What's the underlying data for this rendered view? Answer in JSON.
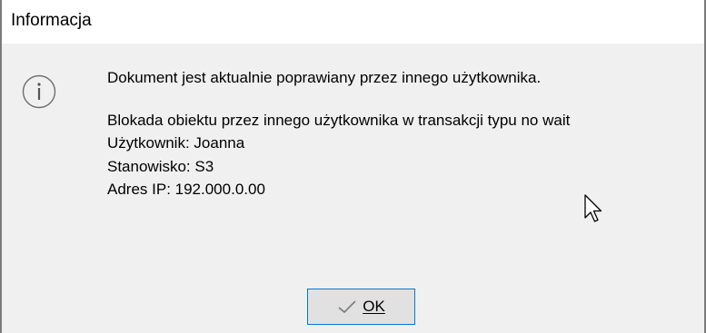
{
  "window": {
    "title": "Informacja"
  },
  "message": {
    "line1": "Dokument jest aktualnie poprawiany przez innego użytkownika.",
    "line2": "Blokada obiektu przez innego użytkownika w transakcji typu no wait",
    "line3": "Użytkownik: Joanna",
    "line4": "Stanowisko: S3",
    "line5": "Adres IP: 192.000.0.00"
  },
  "buttons": {
    "ok_label": "OK"
  },
  "icons": {
    "info": "information-icon",
    "ok": "checkmark-icon",
    "cursor": "mouse-pointer-icon"
  }
}
